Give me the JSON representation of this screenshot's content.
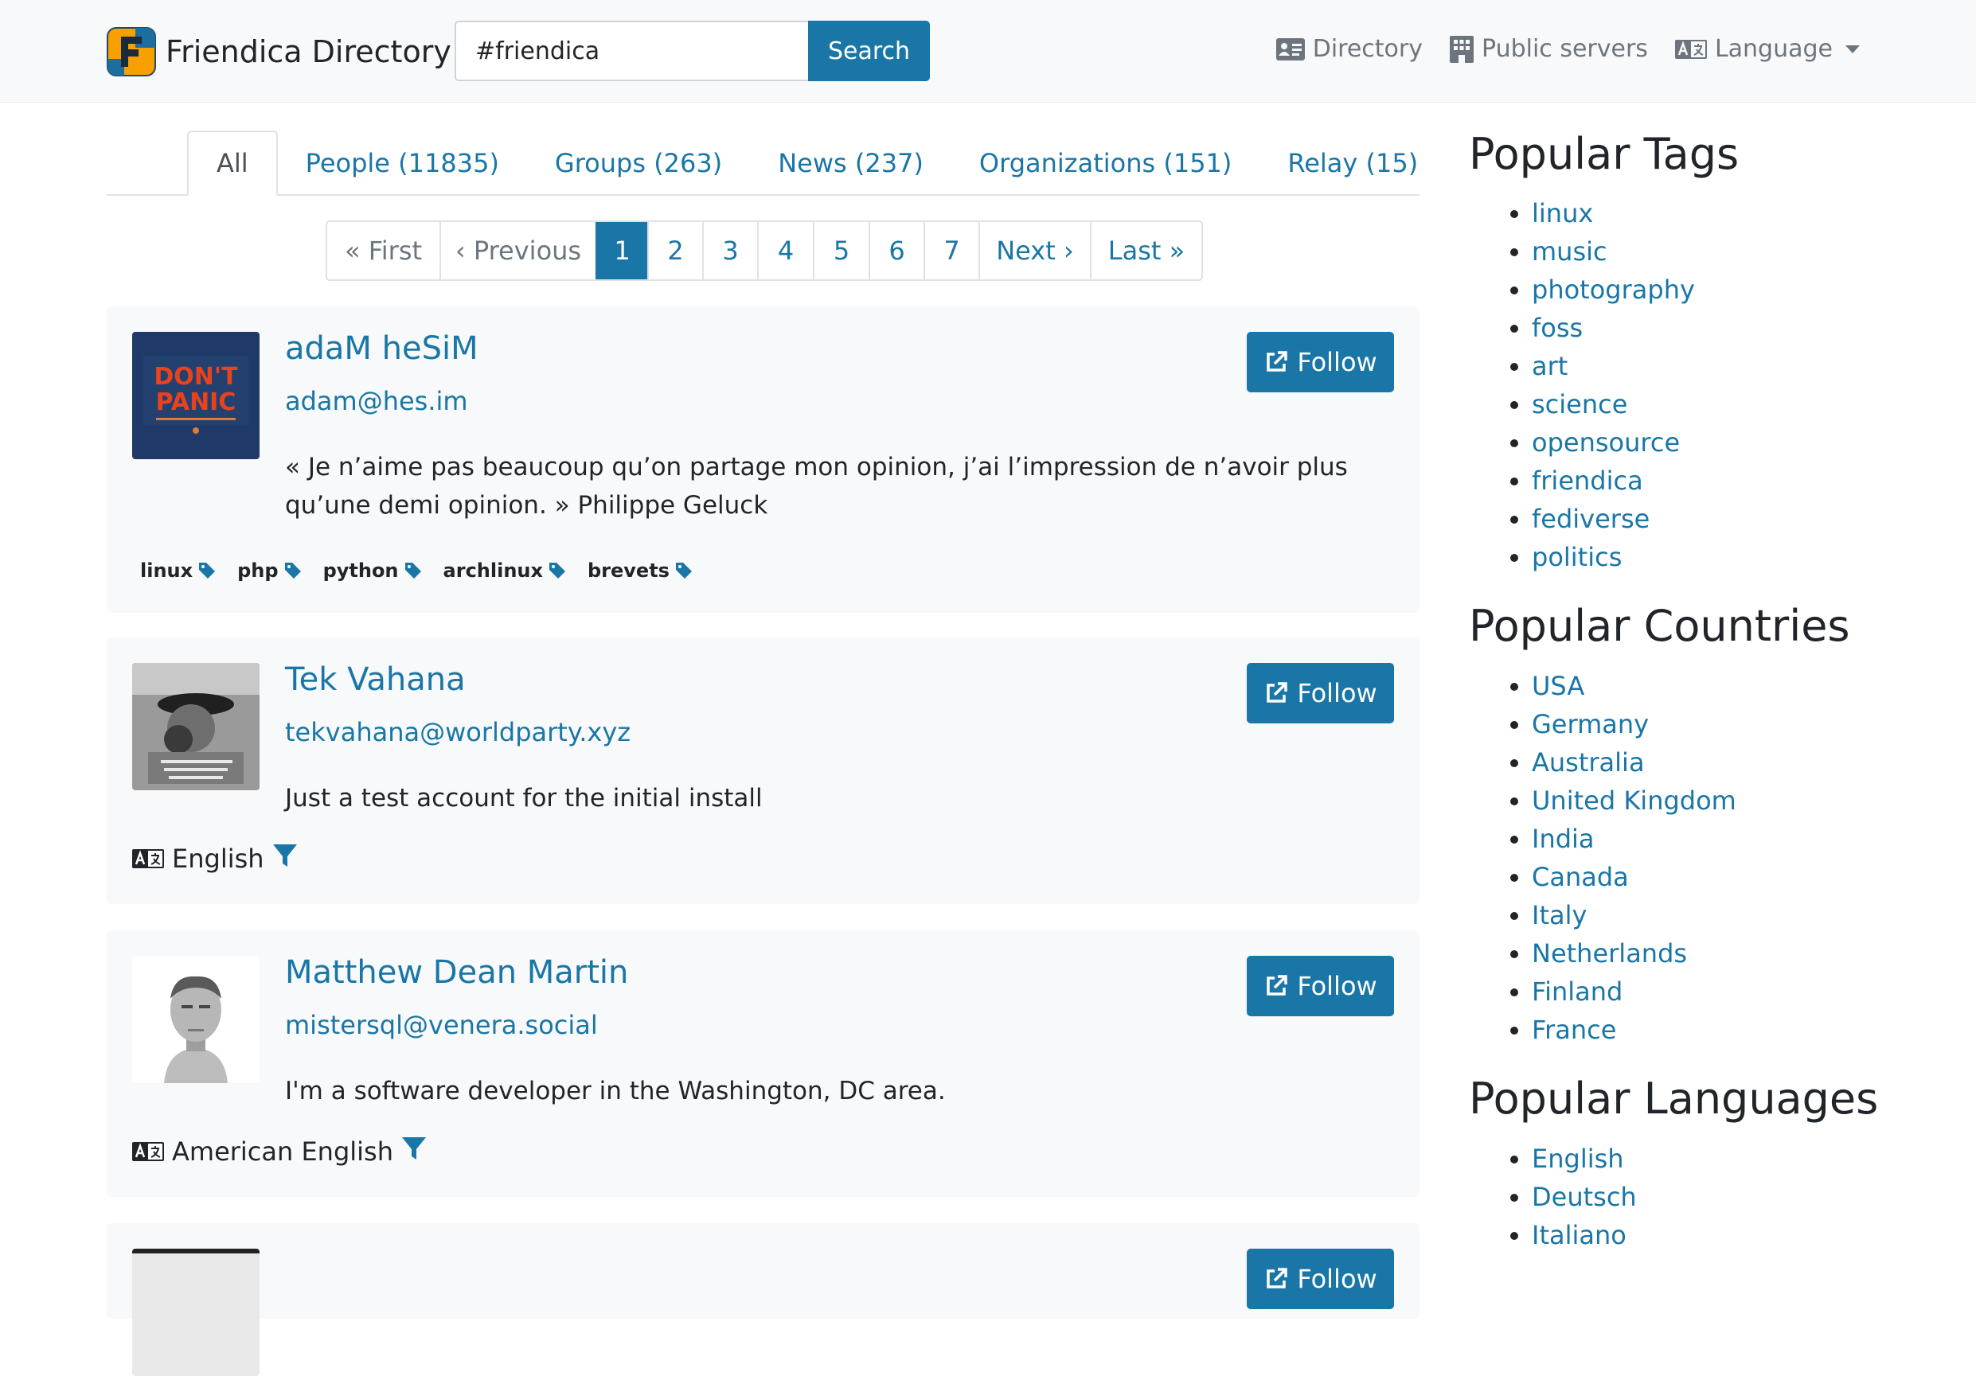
{
  "navbar": {
    "brand": "Friendica Directory",
    "search": {
      "value": "#friendica",
      "button": "Search"
    },
    "links": {
      "directory": "Directory",
      "servers": "Public servers",
      "language": "Language"
    }
  },
  "tabs": [
    {
      "label": "All",
      "active": true
    },
    {
      "label": "People (11835)"
    },
    {
      "label": "Groups (263)"
    },
    {
      "label": "News (237)"
    },
    {
      "label": "Organizations (151)"
    },
    {
      "label": "Relay (15)"
    }
  ],
  "pagination": [
    "« First",
    "‹ Previous",
    "1",
    "2",
    "3",
    "4",
    "5",
    "6",
    "7",
    "Next ›",
    "Last »"
  ],
  "pagination_active": "1",
  "profiles": [
    {
      "name": "adaM heSiM",
      "handle": "adam@hes.im",
      "bio": "« Je n’aime pas beaucoup qu’on partage mon opinion, j’ai l’impression de n’avoir plus qu’une demi opinion. » Philippe Geluck",
      "tags": [
        "linux",
        "php",
        "python",
        "archlinux",
        "brevets"
      ],
      "follow": "Follow",
      "avatar_text": [
        "DON'T",
        "PANIC"
      ]
    },
    {
      "name": "Tek Vahana",
      "handle": "tekvahana@worldparty.xyz",
      "bio": "Just a test account for the initial install",
      "language": "English",
      "follow": "Follow"
    },
    {
      "name": "Matthew Dean Martin",
      "handle": "mistersql@venera.social",
      "bio": "I'm a software developer in the Washington, DC area.",
      "language": "American English",
      "follow": "Follow"
    },
    {
      "follow": "Follow"
    }
  ],
  "sidebar": {
    "tags_title": "Popular Tags",
    "tags": [
      "linux",
      "music",
      "photography",
      "foss",
      "art",
      "science",
      "opensource",
      "friendica",
      "fediverse",
      "politics"
    ],
    "countries_title": "Popular Countries",
    "countries": [
      "USA",
      "Germany",
      "Australia",
      "United Kingdom",
      "India",
      "Canada",
      "Italy",
      "Netherlands",
      "Finland",
      "France"
    ],
    "languages_title": "Popular Languages",
    "languages": [
      "English",
      "Deutsch",
      "Italiano"
    ]
  },
  "colors": {
    "primary": "#1976a6",
    "navbar_bg": "#f8f9fa",
    "card_bg": "#f8f9fa",
    "text": "#212529",
    "muted": "#6c757d"
  },
  "icons": [
    "friendica-logo",
    "address-card-icon",
    "building-icon",
    "language-icon",
    "caret-down-icon",
    "external-link-icon",
    "tag-icon",
    "filter-icon"
  ]
}
